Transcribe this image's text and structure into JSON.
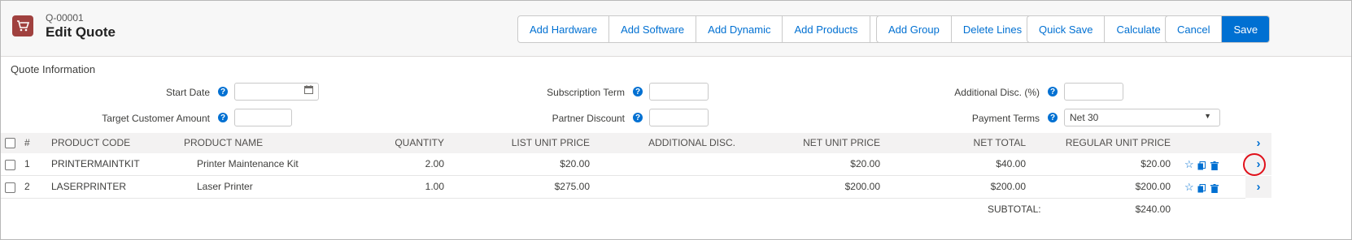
{
  "header": {
    "quote_number": "Q-00001",
    "title": "Edit Quote",
    "buttons_group1": [
      "Add Hardware",
      "Add Software",
      "Add Dynamic",
      "Add Products"
    ],
    "dropdown_glyph": "▼",
    "buttons_group2": [
      "Add Group",
      "Delete Lines"
    ],
    "buttons_group3": [
      "Quick Save",
      "Calculate"
    ],
    "cancel_label": "Cancel",
    "save_label": "Save"
  },
  "section": {
    "title": "Quote Information",
    "start_date_label": "Start Date",
    "start_date_value": "",
    "target_amount_label": "Target Customer Amount",
    "target_amount_value": "",
    "subscription_term_label": "Subscription Term",
    "subscription_term_value": "",
    "partner_discount_label": "Partner Discount",
    "partner_discount_value": "",
    "additional_disc_label": "Additional Disc. (%)",
    "additional_disc_value": "",
    "payment_terms_label": "Payment Terms",
    "payment_terms_value": "Net 30"
  },
  "table": {
    "headers": [
      "#",
      "PRODUCT CODE",
      "PRODUCT NAME",
      "QUANTITY",
      "LIST UNIT PRICE",
      "ADDITIONAL DISC.",
      "NET UNIT PRICE",
      "NET TOTAL",
      "REGULAR UNIT PRICE"
    ],
    "rows": [
      {
        "num": "1",
        "code": "PRINTERMAINTKIT",
        "name": "Printer Maintenance Kit",
        "quantity": "2.00",
        "list_price": "$20.00",
        "additional_disc": "",
        "net_unit_price": "$20.00",
        "net_total": "$40.00",
        "regular_price": "$20.00"
      },
      {
        "num": "2",
        "code": "LASERPRINTER",
        "name": "Laser Printer",
        "quantity": "1.00",
        "list_price": "$275.00",
        "additional_disc": "",
        "net_unit_price": "$200.00",
        "net_total": "$200.00",
        "regular_price": "$200.00"
      }
    ],
    "subtotal_label": "SUBTOTAL:",
    "subtotal_value": "$240.00"
  },
  "colors": {
    "accent": "#0070d2",
    "brand_icon": "#a0413f",
    "highlight_circle": "#e0101a"
  },
  "icons": [
    "cart-icon",
    "help-icon",
    "calendar-icon",
    "star-icon",
    "clone-icon",
    "delete-icon",
    "chevron-right-icon",
    "chevron-down-icon"
  ]
}
